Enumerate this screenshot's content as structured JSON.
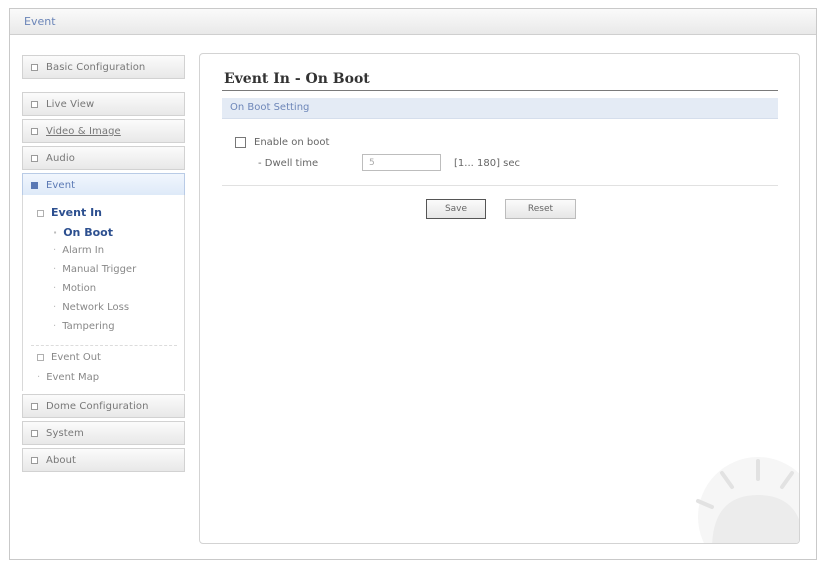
{
  "window": {
    "title": "Event"
  },
  "sidebar": {
    "top_items": [
      {
        "label": "Basic Configuration"
      },
      {
        "label": "Live View"
      },
      {
        "label": "Video & Image"
      },
      {
        "label": "Audio"
      },
      {
        "label": "Event"
      }
    ],
    "event_submenu": {
      "event_in": "Event In",
      "event_in_items": [
        "On Boot",
        "Alarm In",
        "Manual Trigger",
        "Motion",
        "Network Loss",
        "Tampering"
      ],
      "event_out": "Event Out",
      "event_map": "Event Map"
    },
    "bottom_items": [
      {
        "label": "Dome Configuration"
      },
      {
        "label": "System"
      },
      {
        "label": "About"
      }
    ],
    "active_item": "Event",
    "active_subitem": "On Boot"
  },
  "main": {
    "page_title": "Event In - On Boot",
    "section_title": "On Boot Setting",
    "enable_on_boot": {
      "label": "Enable on boot",
      "checked": false
    },
    "dwell_time": {
      "label": "- Dwell time",
      "value": "5",
      "range": "[1... 180] sec"
    },
    "buttons": {
      "save": "Save",
      "reset": "Reset"
    }
  },
  "colors": {
    "accent": "#5b79b4",
    "section_bg": "#e4ebf5",
    "active_text": "#2c4f8f"
  }
}
